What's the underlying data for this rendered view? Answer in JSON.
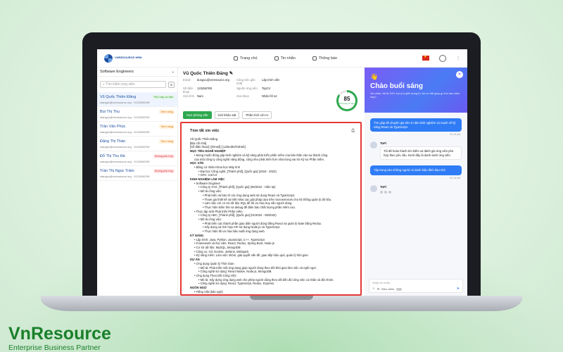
{
  "brand": {
    "name": "VnResource",
    "tagline": "Enterprise Business Partner"
  },
  "app": {
    "logo_text": "VNRESOURCE HRM",
    "nav": [
      "Trang chủ",
      "Tin nhắn",
      "Thông báo"
    ]
  },
  "left": {
    "dropdown": "Software Engineers",
    "search_placeholder": "Tìm kiếm ứng viên",
    "candidates": [
      {
        "name": "Vũ Quốc Thiên Đăng",
        "mail": "ctanguv@vnresource.org · 0123456789",
        "tag": "Phù hợp cơ bản",
        "tag_color": "green"
      },
      {
        "name": "Bùi Thị Thu",
        "mail": "ctanguv@vnresource.org · 0123456789",
        "tag": "Tiềm năng",
        "tag_color": "orange"
      },
      {
        "name": "Trần Văn Phúc",
        "mail": "ctanguv@vnresource.org · 0123456789",
        "tag": "Tiềm năng",
        "tag_color": "orange"
      },
      {
        "name": "Đặng Thị Thảo",
        "mail": "ctanguv@vnresource.org · 0123456789",
        "tag": "Tiềm năng",
        "tag_color": "orange"
      },
      {
        "name": "Đỗ Thị Thu Hà",
        "mail": "ctanguv@vnresource.org · 0123456789",
        "tag": "Không phù hợp",
        "tag_color": "red"
      },
      {
        "name": "Trần Thị Ngọc Trâm",
        "mail": "ctanguv@vnresource.org · 0123456789",
        "tag": "Không phù hợp",
        "tag_color": "red"
      }
    ]
  },
  "profile": {
    "name": "Vũ Quốc Thiên Đăng",
    "rows": [
      [
        "Email",
        "dungvu@vnresource.org",
        "Công việc gần nhất",
        "Lập trình viên"
      ],
      [
        "Số điện thoại",
        "123456789",
        "Nguồn ứng viên",
        "TopCV"
      ],
      [
        "Giới tính",
        "Nam",
        "Giai đoạn",
        "Nhận hồ sơ"
      ]
    ],
    "buttons": [
      "Hẹn phỏng vấn",
      "Gửi khảo sát",
      "Phân tích với AI"
    ],
    "score": "85",
    "score_label": "Phù hợp cơ bản"
  },
  "summary": {
    "title": "Tóm tắt xin việc",
    "lines": [
      {
        "t": "Vũ Quốc Thiên Đăng",
        "l": 0
      },
      {
        "t": "[Địa chỉ nhà]",
        "l": 0
      },
      {
        "t": "[Số điện thoại] | [Email] | [LinkedIn/GitHub]",
        "l": 0
      },
      {
        "t": "MỤC TIÊU NGHỀ NGHIỆP",
        "l": 0,
        "h": true
      },
      {
        "t": "• Mong muốn đóng góp kinh nghiệm và kỹ năng phát triển phần mềm của bản thân vào sự thành công",
        "l": 1
      },
      {
        "t": "của một công ty công nghệ năng động, cũng như phát triển hơn nữa trong vai trò Kỹ sư Phần mềm.",
        "l": 1
      },
      {
        "t": "HỌC VẤN",
        "l": 0,
        "h": true
      },
      {
        "t": "• Bằng cử nhân Khoa học Máy tính",
        "l": 1
      },
      {
        "t": "• Đại học Công nghệ, [Thành phố], [Quốc gia] (2018 - 2022)",
        "l": 2
      },
      {
        "t": "• GPA: 3.5/4.0",
        "l": 2
      },
      {
        "t": "KINH NGHIỆM LÀM VIỆC",
        "l": 0,
        "h": true
      },
      {
        "t": "• Software Engineer",
        "l": 1
      },
      {
        "t": "• Công ty XYZ, [Thành phố], [Quốc gia] (06/2022 - Hiện tại)",
        "l": 2
      },
      {
        "t": "• Mô tả công việc:",
        "l": 2
      },
      {
        "t": "• Phát triển và bảo trì các ứng dụng web sử dụng React và TypeScript.",
        "l": 3
      },
      {
        "t": "• Tham gia thiết kế và triển khai các giải pháp dựa trên microservices cho hệ thống quản lý dữ liệu.",
        "l": 3
      },
      {
        "t": "• Làm việc với cơ sở dữ liệu SQL để tối ưu hóa truy vấn người dùng.",
        "l": 3
      },
      {
        "t": "• Thực hiện kiểm thử và debug để đảm bảo chất lượng phần mềm cao.",
        "l": 3
      },
      {
        "t": "• Thực tập sinh Phát triển Phần mềm",
        "l": 1
      },
      {
        "t": "• Công ty ABC, [Thành phố], [Quốc gia] (01/2022 - 05/2022)",
        "l": 2
      },
      {
        "t": "• Mô tả công việc:",
        "l": 2
      },
      {
        "t": "• Phát triển các thành phần giao diện người dùng bằng React và quản lý state bằng Redux.",
        "l": 3
      },
      {
        "t": "• Xây dựng và tích hợp API sử dụng Node.js và TypeScript.",
        "l": 3
      },
      {
        "t": "• Thực hiện tối ưu hóa hiệu suất ứng dụng web.",
        "l": 3
      },
      {
        "t": "KỸ NĂNG",
        "l": 0,
        "h": true
      },
      {
        "t": "• Lập trình: Java, Python, JavaScript, C++, TypeScript",
        "l": 1
      },
      {
        "t": "• Framework và thư viện: React, Redux, Spring Boot, Node.js",
        "l": 1
      },
      {
        "t": "• Cơ sở dữ liệu: MySQL, MongoDB",
        "l": 1
      },
      {
        "t": "• Công cụ: Git, Docker, Jenkins, Webpack",
        "l": 1
      },
      {
        "t": "• Kỹ năng mềm: Làm việc nhóm, giải quyết vấn đề, giao tiếp hiệu quả, quản lý thời gian",
        "l": 1
      },
      {
        "t": "DỰ ÁN",
        "l": 0,
        "h": true
      },
      {
        "t": "• Ứng dụng Quản lý Thời Gian",
        "l": 1
      },
      {
        "t": "• Mô tả: Phát triển một ứng dụng giúp người dùng theo dõi thời gian làm việc và nghỉ ngơi.",
        "l": 2
      },
      {
        "t": "• Công nghệ sử dụng: React Native, Node.js, MongoDB.",
        "l": 2
      },
      {
        "t": "• Ứng dụng Theo Dõi Công Việc",
        "l": 1
      },
      {
        "t": "• Mô tả: Xây dựng ứng dụng web cho phép người dùng theo dõi tiến độ công việc cá nhân và đội nhóm.",
        "l": 2
      },
      {
        "t": "• Công nghệ sử dụng: React, TypeScript, Redux, Express.",
        "l": 2
      },
      {
        "t": "NGÔN NGỮ",
        "l": 0,
        "h": true
      },
      {
        "t": "• Tiếng Việt (bản ngữ)",
        "l": 1
      }
    ]
  },
  "chat": {
    "greeting": "Chào buổi sáng",
    "subtitle": "Xin chào, tôi là ToFi, trợ lý tuyển dụng AI, tôi có thể giúp gì cho bạn hôm nay?",
    "messages": [
      {
        "from": "user",
        "text": "Tìm giúp tôi chuyên gia trên 5 năm kinh nghiệm và mạnh về kỹ năng React và TypeScript",
        "time": "09:15 AM"
      },
      {
        "from": "bot",
        "name": "ToFi",
        "text": "Tôi đã hoàn thành tìm kiếm và đánh giá ứng viên phù hợp theo yêu cầu. Dưới đây là danh sách ứng viên."
      },
      {
        "from": "user",
        "text": "Tập trung vào những người có danh hiệu lãnh đạo nhé",
        "time": "09:16 AM"
      },
      {
        "from": "bot",
        "name": "ToFi",
        "typing": true
      }
    ],
    "input_placeholder": "Nhập tin nhắn...",
    "footer_label": "Điều chỉnh"
  }
}
